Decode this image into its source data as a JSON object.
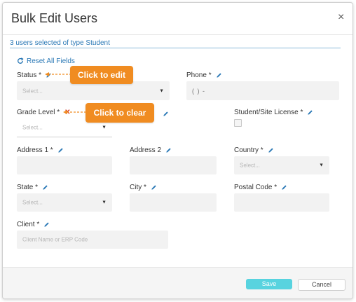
{
  "dialog": {
    "title": "Bulk Edit Users",
    "close_glyph": "×"
  },
  "selection_text": "3 users selected of type Student",
  "reset_label": "Reset All Fields",
  "fields": {
    "status": {
      "label": "Status *",
      "placeholder": "Select..."
    },
    "phone": {
      "label": "Phone *",
      "value": "( )  -"
    },
    "grade_level": {
      "label": "Grade Level *",
      "placeholder": "Select..."
    },
    "license": {
      "label": "Student/Site License *"
    },
    "address1": {
      "label": "Address 1 *"
    },
    "address2": {
      "label": "Address 2"
    },
    "country": {
      "label": "Country *",
      "placeholder": "Select..."
    },
    "state": {
      "label": "State *",
      "placeholder": "Select..."
    },
    "city": {
      "label": "City *"
    },
    "postal_code": {
      "label": "Postal Code *"
    },
    "client": {
      "label": "Client *",
      "placeholder": "Client Name or ERP Code"
    }
  },
  "callouts": {
    "edit": "Click to edit",
    "clear": "Click to clear"
  },
  "footer": {
    "save_label": "Save",
    "cancel_label": "Cancel"
  },
  "icons": {
    "edit": "pencil-icon",
    "clear": "x-icon",
    "reset": "refresh-icon",
    "dropdown": "caret-down-icon"
  },
  "colors": {
    "accent": "#2b79b6",
    "callout": "#f08c21",
    "save": "#58d3df",
    "clear": "#d23a2a"
  }
}
